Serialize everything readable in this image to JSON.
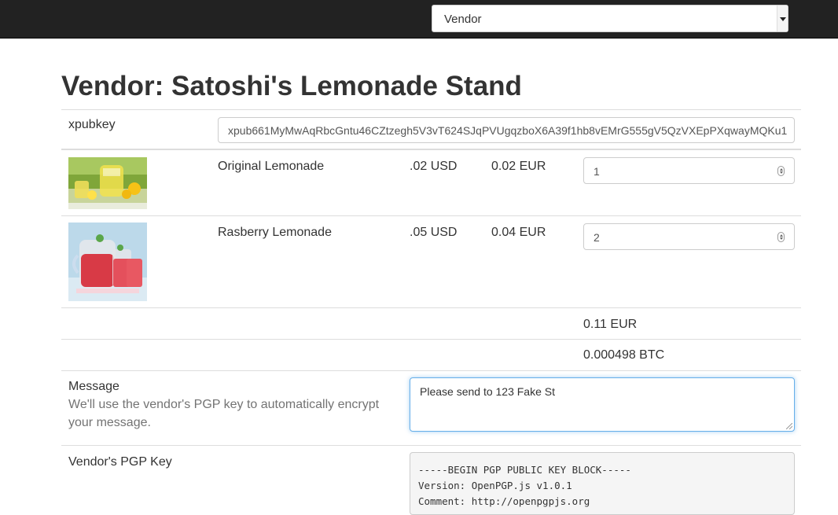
{
  "navbar": {
    "select_value": "Vendor"
  },
  "page": {
    "title": "Vendor: Satoshi's Lemonade Stand"
  },
  "xpub": {
    "label": "xpubkey",
    "value": "xpub661MyMwAqRbcGntu46CZtzegh5V3vT624SJqPVUgqzboX6A39f1hb8vEMrG555gV5QzVXEpPXqwayMQKu1"
  },
  "products": [
    {
      "name": "Original Lemonade",
      "price_usd": ".02 USD",
      "price_eur": "0.02 EUR",
      "quantity": "1",
      "image": "lemonade-image"
    },
    {
      "name": "Rasberry Lemonade",
      "price_usd": ".05 USD",
      "price_eur": "0.04 EUR",
      "quantity": "2",
      "image": "raspberry-lemonade-image"
    }
  ],
  "totals": {
    "eur": "0.11 EUR",
    "btc": "0.000498 BTC"
  },
  "message": {
    "label": "Message",
    "help": "We'll use the vendor's PGP key to automatically encrypt your message.",
    "value": "Please send to 123 Fake St"
  },
  "pgp": {
    "label": "Vendor's PGP Key",
    "text": "-----BEGIN PGP PUBLIC KEY BLOCK-----\nVersion: OpenPGP.js v1.0.1\nComment: http://openpgpjs.org"
  },
  "colors": {
    "navbar": "#222222",
    "focus": "#66afe9"
  }
}
